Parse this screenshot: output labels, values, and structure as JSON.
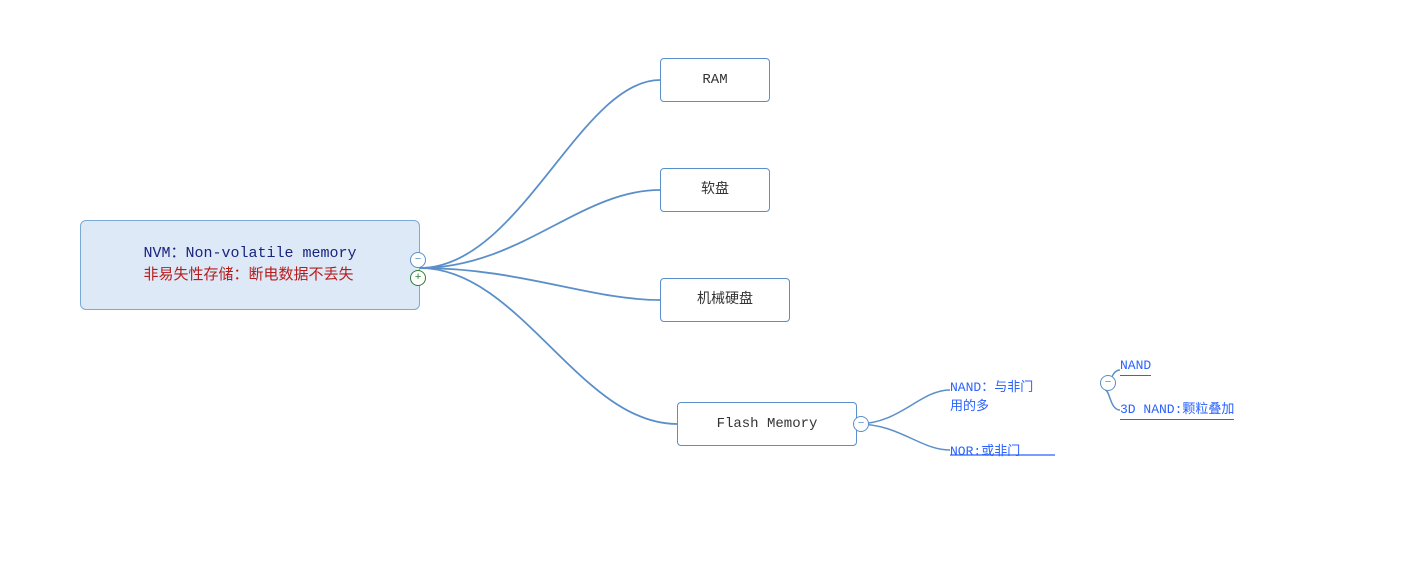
{
  "nodes": {
    "root": {
      "line1": "NVM：Non-volatile memory",
      "line2": "非易失性存储：断电数据不丢失"
    },
    "ram": {
      "label": "RAM"
    },
    "floppy": {
      "label": "软盘"
    },
    "hdd": {
      "label": "机械硬盘"
    },
    "flash": {
      "label": "Flash Memory"
    },
    "nand_label": {
      "label": "NAND：与非门\n用的多"
    },
    "nor_label": {
      "label": "NOR:或非门"
    },
    "nand_child": {
      "label": "NAND"
    },
    "threednand_child": {
      "label": "3D NAND:颗粒叠加"
    }
  },
  "toggles": {
    "root_minus": "−",
    "root_plus": "+",
    "flash_minus": "−",
    "nand_minus": "−"
  },
  "colors": {
    "border": "#5b8fc9",
    "root_bg": "#dde9f7",
    "line_color": "#5b8fc9",
    "text_dark": "#1a237e",
    "text_red": "#b71c1c",
    "sub_text": "#2962ff"
  }
}
